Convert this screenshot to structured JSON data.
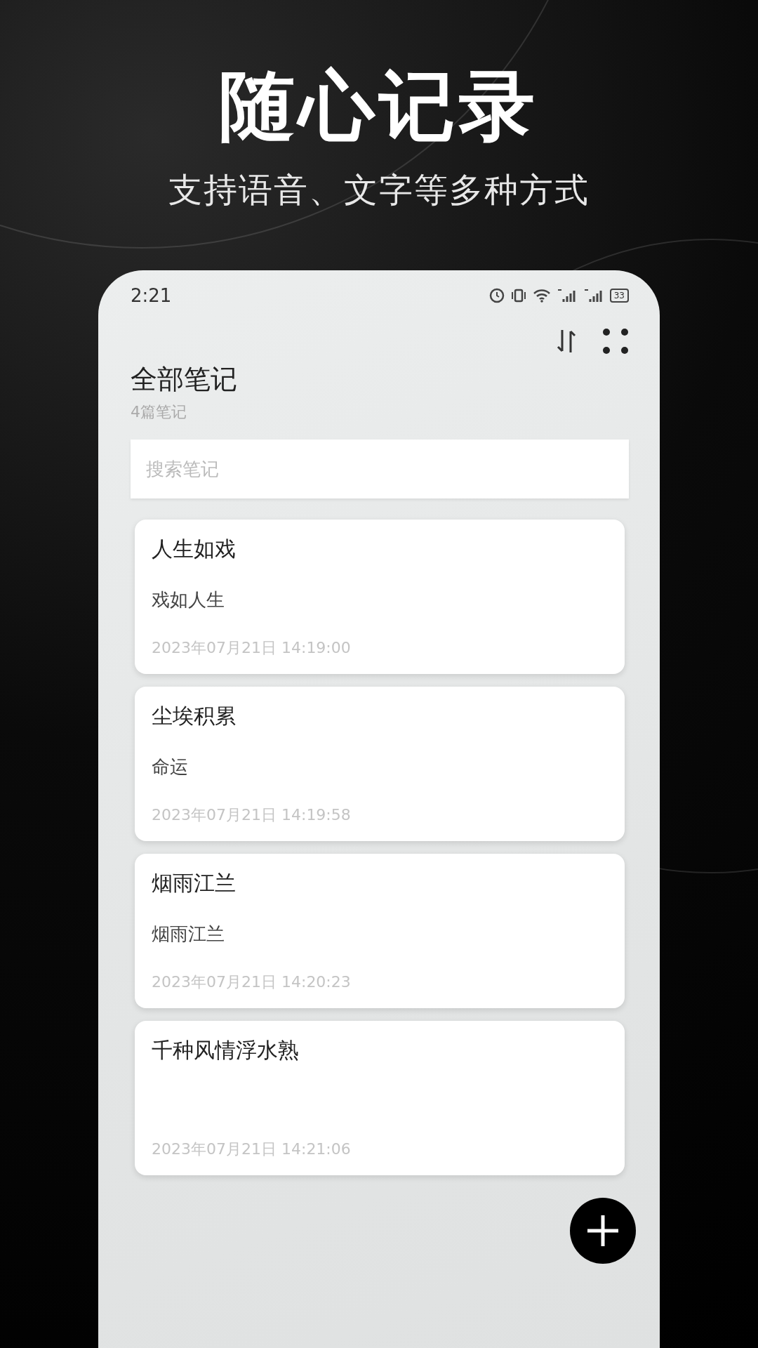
{
  "headline": "随心记录",
  "tagline": "支持语音、文字等多种方式",
  "status_bar": {
    "time": "2:21",
    "battery": "33"
  },
  "header": {
    "title": "全部笔记",
    "count": "4篇笔记"
  },
  "search": {
    "placeholder": "搜索笔记"
  },
  "notes": [
    {
      "title": "人生如戏",
      "body": "戏如人生",
      "date": "2023年07月21日 14:19:00"
    },
    {
      "title": "尘埃积累",
      "body": "命运",
      "date": "2023年07月21日 14:19:58"
    },
    {
      "title": "烟雨江兰",
      "body": "烟雨江兰",
      "date": "2023年07月21日 14:20:23"
    },
    {
      "title": "千种风情浮水熟",
      "date": "2023年07月21日 14:21:06"
    }
  ]
}
